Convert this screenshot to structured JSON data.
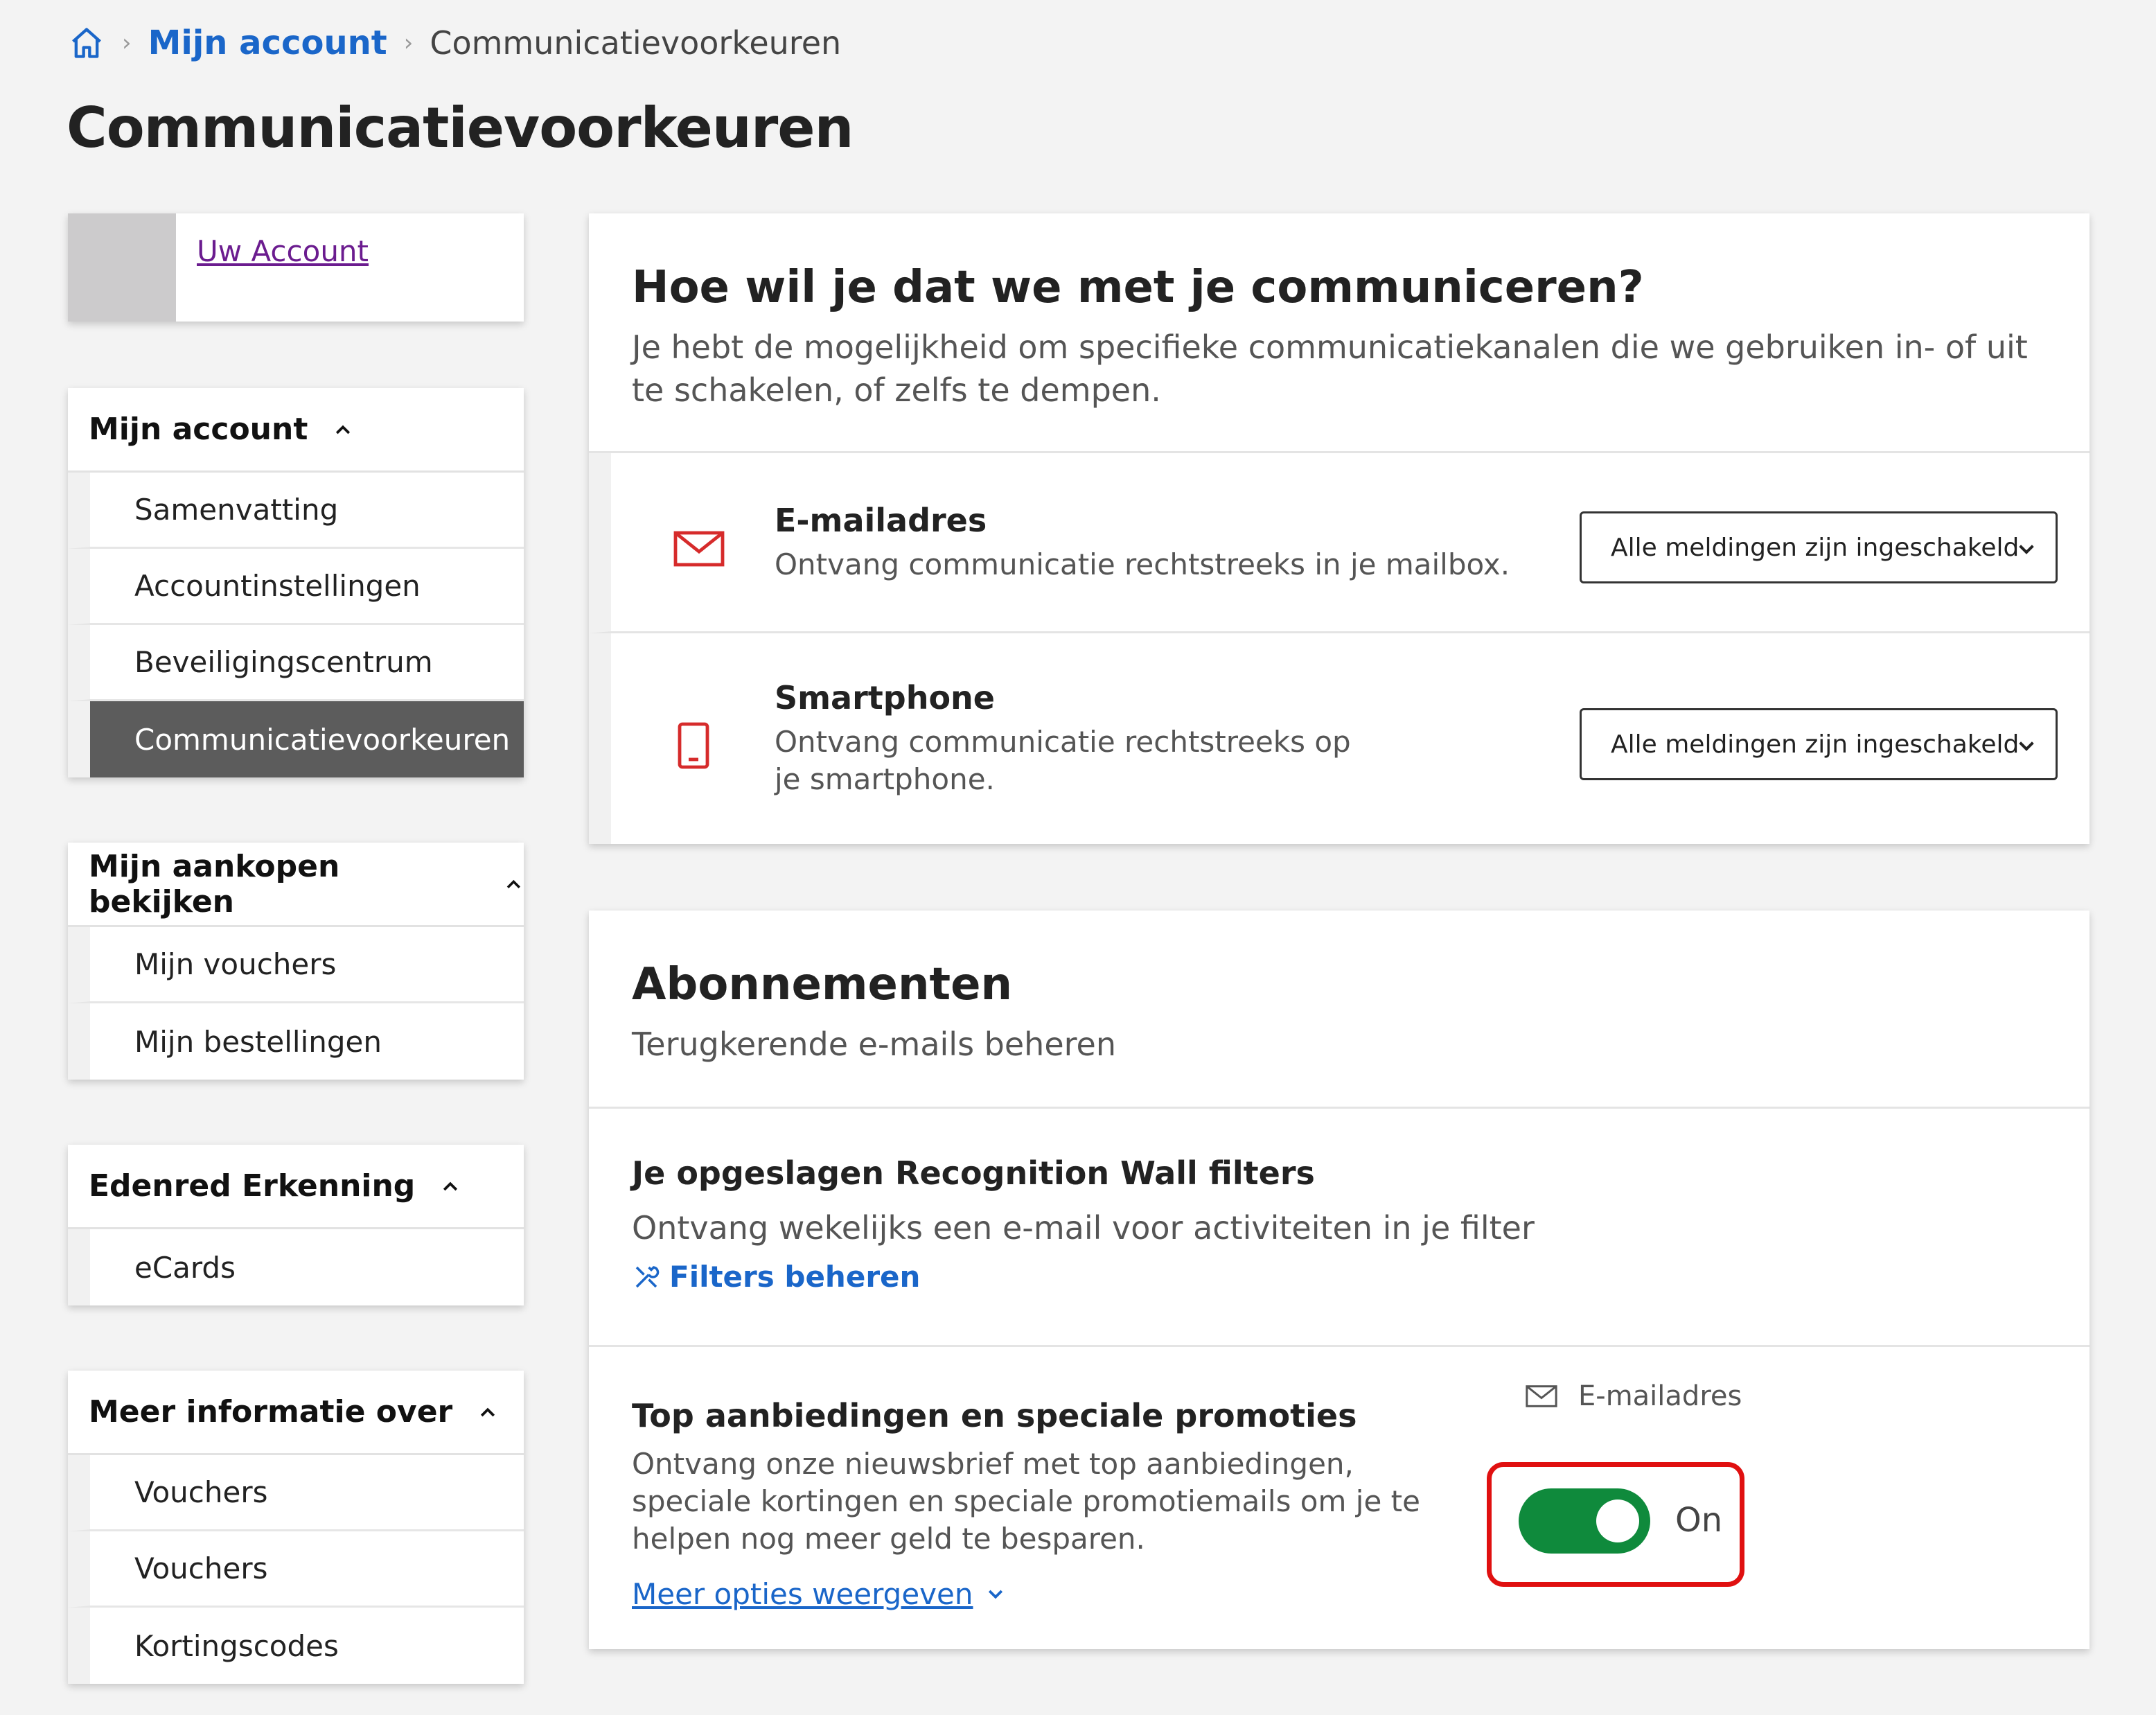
{
  "breadcrumb": {
    "home_icon": "home-icon",
    "account_link": "Mijn account",
    "current": "Communicatievoorkeuren"
  },
  "page_title": "Communicatievoorkeuren",
  "account_card": {
    "link": "Uw Account"
  },
  "sidebar": {
    "groups": [
      {
        "title": "Mijn account",
        "items": [
          "Samenvatting",
          "Accountinstellingen",
          "Beveiligingscentrum",
          "Communicatievoorkeuren"
        ],
        "active": 3
      },
      {
        "title": "Mijn aankopen bekijken",
        "items": [
          "Mijn vouchers",
          "Mijn bestellingen"
        ]
      },
      {
        "title": "Edenred Erkenning",
        "items": [
          "eCards"
        ]
      },
      {
        "title": "Meer informatie over",
        "items": [
          "Vouchers",
          "Vouchers",
          "Kortingscodes"
        ]
      }
    ]
  },
  "communication": {
    "title": "Hoe wil je dat we met je communiceren?",
    "subtitle": "Je hebt de mogelijkheid om specifieke communicatiekanalen die we gebruiken in- of uit te schakelen, of zelfs te dempen.",
    "channels": [
      {
        "icon": "envelope-icon",
        "title": "E-mailadres",
        "desc": "Ontvang communicatie rechtstreeks in je mailbox.",
        "select_value": "Alle meldingen zijn ingeschakeld"
      },
      {
        "icon": "smartphone-icon",
        "title": "Smartphone",
        "desc": "Ontvang communicatie rechtstreeks op je smartphone.",
        "select_value": "Alle meldingen zijn ingeschakeld"
      }
    ]
  },
  "subscriptions": {
    "title": "Abonnementen",
    "subtitle": "Terugkerende e-mails beheren",
    "recognition": {
      "title": "Je opgeslagen Recognition Wall filters",
      "desc": "Ontvang wekelijks een e-mail voor activiteiten in je filter",
      "link": "Filters beheren"
    },
    "promotions": {
      "title": "Top aanbiedingen en speciale promoties",
      "desc": "Ontvang onze nieuwsbrief met top aanbiedingen, speciale kortingen en speciale promotiemails om je te helpen nog meer geld te besparen.",
      "more_link": "Meer opties weergeven",
      "channel_label": "E-mailadres",
      "toggle_state": "On"
    }
  },
  "colors": {
    "accent_blue": "#1a66c9",
    "toggle_green": "#0f8a3c",
    "highlight_red": "#e01010",
    "icon_red": "#d62b2b",
    "active_nav": "#5c5c5c"
  }
}
